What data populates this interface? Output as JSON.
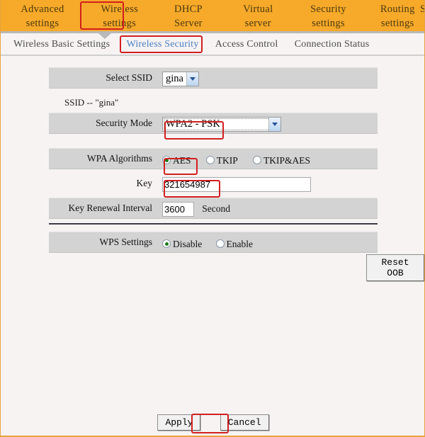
{
  "topnav": {
    "items": [
      {
        "line1": "Advanced",
        "line2": "settings",
        "highlighted": false
      },
      {
        "line1": "Wireless",
        "line2": "settings",
        "highlighted": true
      },
      {
        "line1": "DHCP",
        "line2": "Server",
        "highlighted": false
      },
      {
        "line1": "Virtual",
        "line2": "server",
        "highlighted": false
      },
      {
        "line1": "Security",
        "line2": "settings",
        "highlighted": false
      },
      {
        "line1": "Routing",
        "line2": "settings",
        "highlighted": false
      }
    ],
    "clipped_item": "S"
  },
  "subtabs": {
    "items": [
      {
        "label": "Wireless Basic Settings",
        "active": false
      },
      {
        "label": "Wireless Security",
        "active": true
      },
      {
        "label": "Access Control",
        "active": false
      },
      {
        "label": "Connection Status",
        "active": false
      }
    ]
  },
  "form": {
    "select_ssid": {
      "label": "Select SSID",
      "value": "gina",
      "options": [
        "gina"
      ]
    },
    "ssid_note": "SSID -- \"gina\"",
    "security_mode": {
      "label": "Security Mode",
      "value": "WPA2 - PSK",
      "options": [
        "WPA2 - PSK"
      ]
    },
    "wpa_algorithms": {
      "label": "WPA Algorithms",
      "options": [
        {
          "label": "AES",
          "selected": true
        },
        {
          "label": "TKIP",
          "selected": false
        },
        {
          "label": "TKIP&AES",
          "selected": false
        }
      ]
    },
    "key": {
      "label": "Key",
      "value": "321654987"
    },
    "key_renewal": {
      "label": "Key Renewal Interval",
      "value": "3600",
      "unit": "Second"
    },
    "wps_settings": {
      "label": "WPS Settings",
      "options": [
        {
          "label": "Disable",
          "selected": true
        },
        {
          "label": "Enable",
          "selected": false
        }
      ]
    },
    "reset_oob_label": "Reset OOB"
  },
  "footer": {
    "apply_label": "Apply",
    "cancel_label": "Cancel"
  },
  "colors": {
    "nav_orange": "#f7a929",
    "band_gray": "#d3d3d3",
    "page_background": "#f7f3f3",
    "active_tab_blue": "#4a7fc1",
    "annotation_red": "#d21f1f",
    "radio_dot_green": "#1a7a1a"
  }
}
